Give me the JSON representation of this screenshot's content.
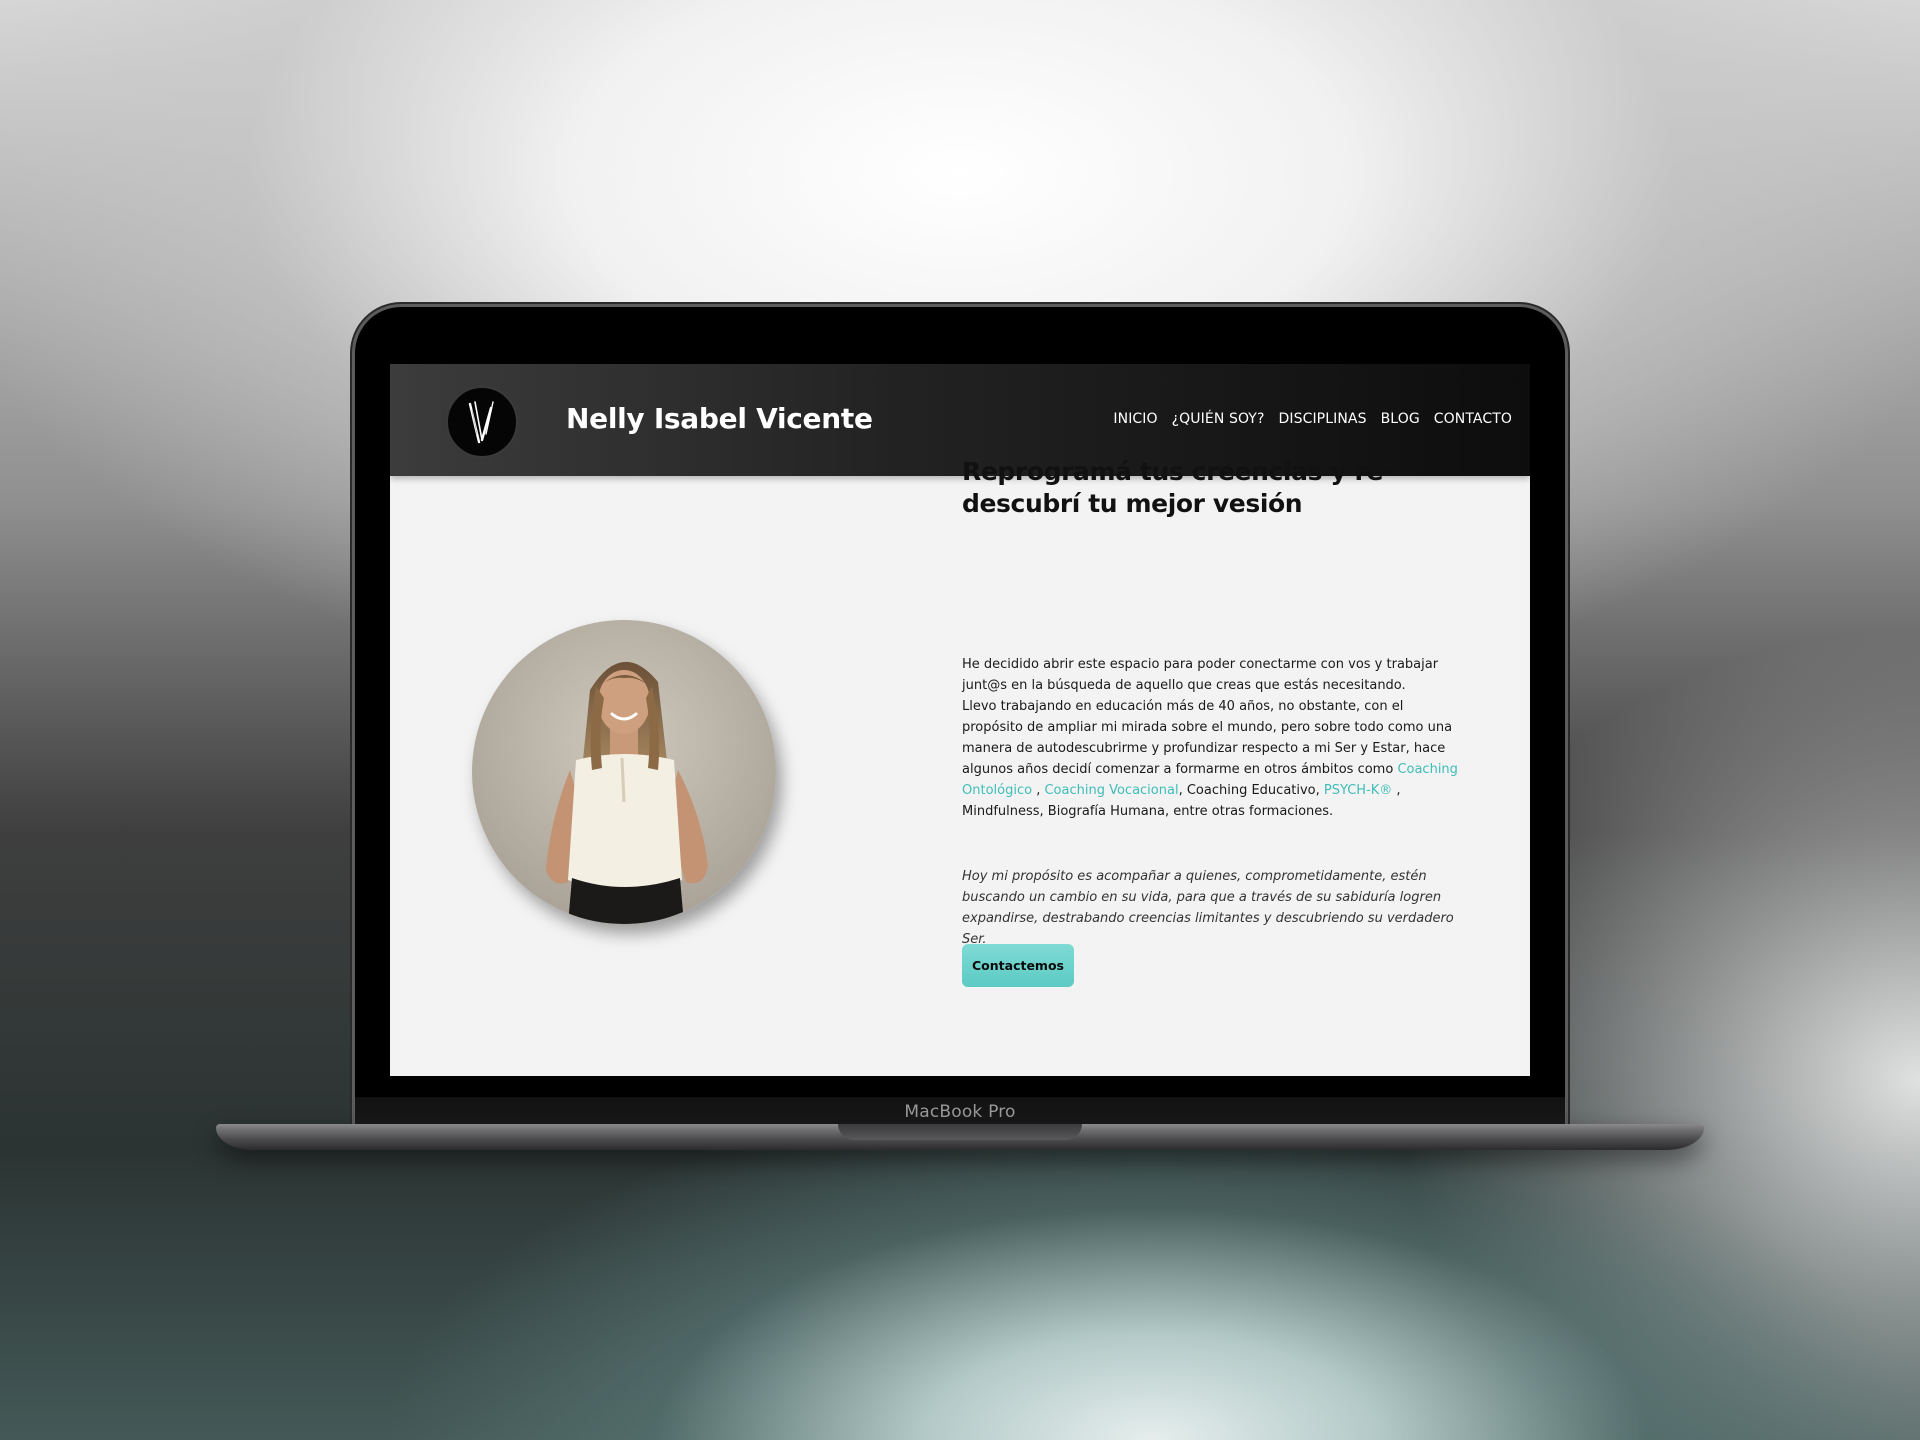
{
  "device": {
    "brand_label": "MacBook Pro"
  },
  "site": {
    "title": "Nelly Isabel Vicente",
    "nav": [
      "INICIO",
      "¿QUIÉN SOY?",
      "DISCIPLINAS",
      "BLOG",
      "CONTACTO"
    ],
    "accent_color": "#5ccac4",
    "header_color": "#1e1e1e"
  },
  "hero": {
    "heading": "Reprogramá tus creencias y re-descubrí tu mejor vesión",
    "p1": "He decidido abrir este espacio para poder conectarme con vos y trabajar junt@s en la búsqueda de aquello que creas que estás necesitando.",
    "p2": {
      "pre": "Llevo trabajando en educación más de 40 años, no obstante, con el propósito de ampliar mi mirada sobre el mundo, pero sobre todo como una manera de autodescubrirme y profundizar respecto a mi Ser y Estar, hace algunos años decidí comenzar a formarme en otros ámbitos como ",
      "link1": "Coaching Ontológico",
      "sep1": " , ",
      "link2": "Coaching Vocacional",
      "mid": ", Coaching Educativo, ",
      "link3": "PSYCH-K®",
      "post": " , Mindfulness, Biografía Humana, entre otras formaciones."
    },
    "p3": "Hoy mi propósito es acompañar a quienes, comprometidamente, estén buscando un cambio en su vida, para que a través de su sabiduría logren expandirse, destrabando creencias limitantes y descubriendo su verdadero Ser.",
    "cta_label": "Contactemos"
  }
}
